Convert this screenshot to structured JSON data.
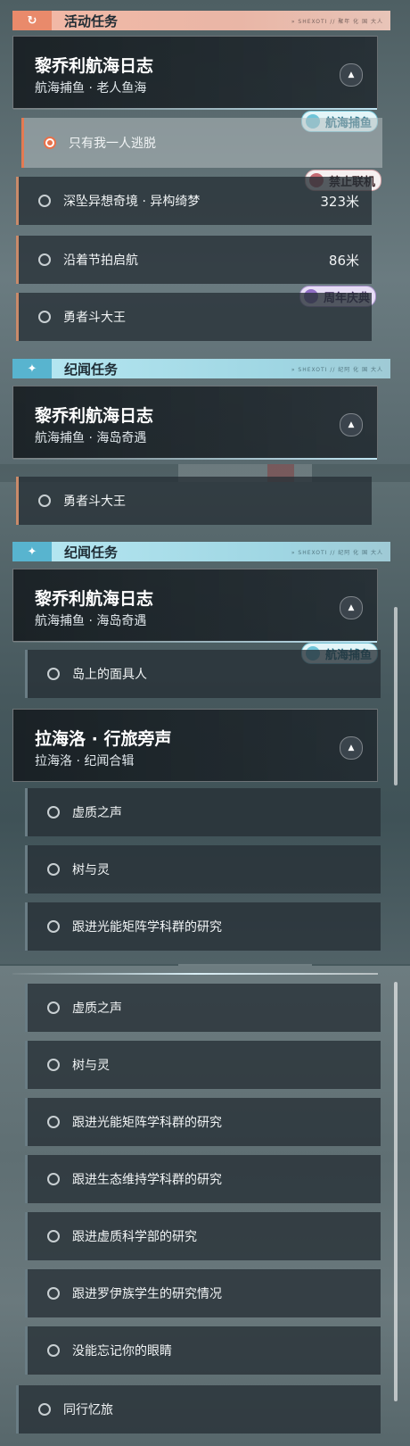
{
  "event_section": {
    "title": "活动任务",
    "badge_icon": "return-icon",
    "tag": "» SHEXOTI // 聚年 化 国 大人"
  },
  "story_section": {
    "title": "纪闻任务",
    "badge_icon": "sparkle-icon",
    "tag": "» SHEXOTI // 纪阿 化 国 大人"
  },
  "panel1": {
    "card": {
      "title": "黎乔利航海日志",
      "subtitle": "航海捕鱼 · 老人鱼海"
    },
    "rows": [
      {
        "label": "只有我一人逃脱",
        "selected": true
      },
      {
        "label": "深坠异想奇境 · 异构绮梦",
        "dist": "323米"
      },
      {
        "label": "沿着节拍启航",
        "dist": "86米"
      },
      {
        "label": "勇者斗大王"
      }
    ],
    "chips": {
      "fishing": "航海捕鱼",
      "ban": "禁止联机",
      "anniversary": "周年庆典"
    },
    "story_card": {
      "title": "黎乔利航海日志",
      "subtitle": "航海捕鱼 · 海岛奇遇"
    }
  },
  "panel2": {
    "top_row": "勇者斗大王",
    "card1": {
      "title": "黎乔利航海日志",
      "subtitle": "航海捕鱼 · 海岛奇遇"
    },
    "chip": "航海捕鱼",
    "row1": "岛上的面具人",
    "card2": {
      "title": "拉海洛 · 行旅旁声",
      "subtitle": "拉海洛 · 纪闻合辑"
    },
    "rows": [
      "虚质之声",
      "树与灵",
      "跟进光能矩阵学科群的研究"
    ]
  },
  "panel3": {
    "rows": [
      "虚质之声",
      "树与灵",
      "跟进光能矩阵学科群的研究",
      "跟进生态维持学科群的研究",
      "跟进虚质科学部的研究",
      "跟进罗伊族学生的研究情况",
      "没能忘记你的眼睛",
      "同行忆旅"
    ]
  }
}
